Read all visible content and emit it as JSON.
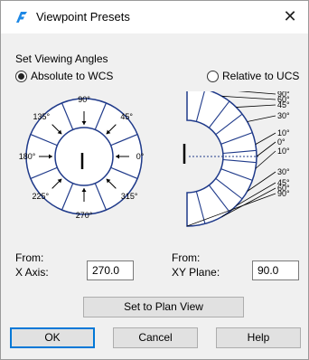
{
  "window": {
    "title": "Viewpoint Presets",
    "close_glyph": "✕"
  },
  "angles": {
    "group_label": "Set Viewing Angles",
    "option_wcs": "Absolute to WCS",
    "option_ucs": "Relative to UCS",
    "selected": "Absolute to WCS"
  },
  "x_axis_dial": {
    "labels": [
      "90°",
      "45°",
      "0°",
      "315°",
      "270°",
      "225°",
      "180°",
      "135°"
    ]
  },
  "xy_plane_dial": {
    "labels": [
      "90°",
      "60°",
      "45°",
      "30°",
      "10°",
      "0°",
      "10°",
      "30°",
      "45°",
      "60°",
      "90°"
    ]
  },
  "fields": {
    "x_axis": {
      "from_label": "From:",
      "label": "X Axis:",
      "value": "270.0"
    },
    "xy_plane": {
      "from_label": "From:",
      "label": "XY Plane:",
      "value": "90.0"
    }
  },
  "buttons": {
    "plan_view": "Set to Plan View",
    "ok": "OK",
    "cancel": "Cancel",
    "help": "Help"
  },
  "colors": {
    "accent": "#1f3a8a",
    "dial_stroke": "#1f3a8a",
    "default_button_border": "#0078d7",
    "icon": "#1e88e5"
  }
}
